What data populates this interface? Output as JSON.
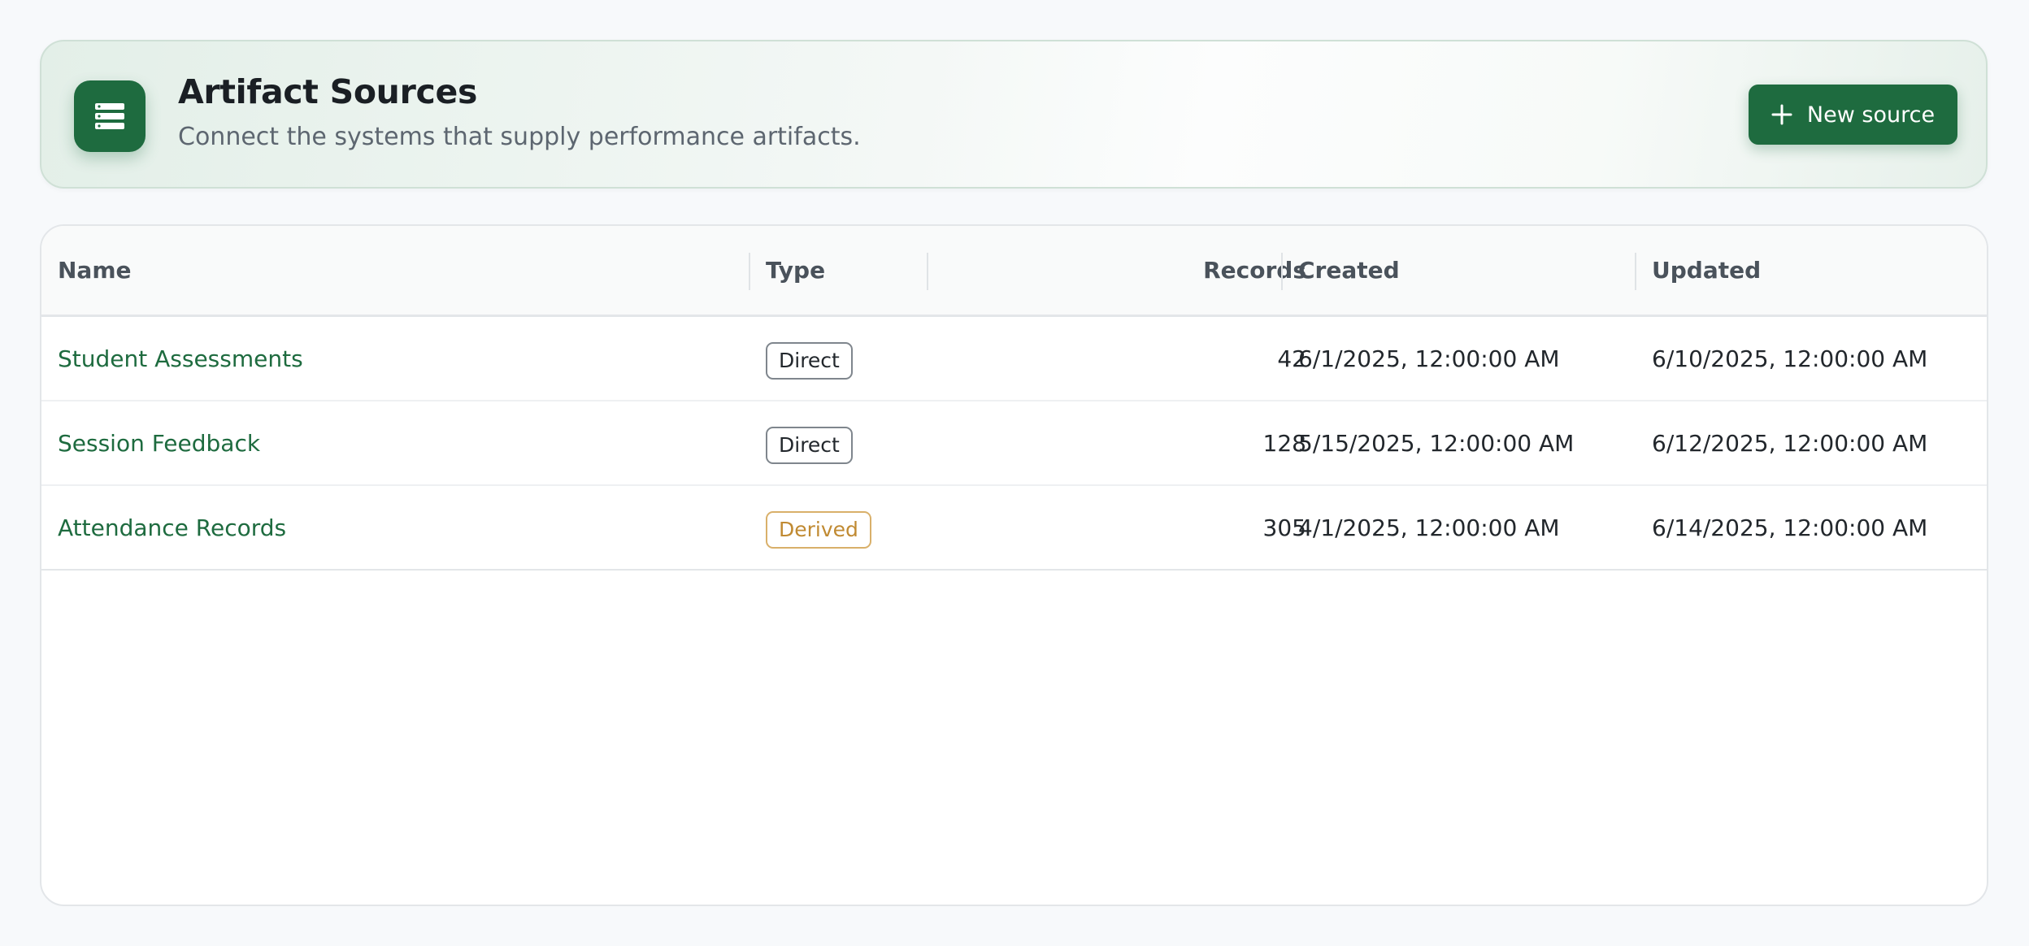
{
  "header": {
    "icon": "database-list-icon",
    "title": "Artifact Sources",
    "subtitle": "Connect the systems that supply performance artifacts.",
    "new_source_label": "New source",
    "new_source_icon": "plus-icon",
    "accent_color": "#1e6b3f"
  },
  "table": {
    "columns": {
      "name": "Name",
      "type": "Type",
      "records": "Records",
      "created": "Created",
      "updated": "Updated"
    },
    "rows": [
      {
        "name": "Student Assessments",
        "type": "Direct",
        "records": "42",
        "created": "6/1/2025, 12:00:00 AM",
        "updated": "6/10/2025, 12:00:00 AM"
      },
      {
        "name": "Session Feedback",
        "type": "Direct",
        "records": "128",
        "created": "5/15/2025, 12:00:00 AM",
        "updated": "6/12/2025, 12:00:00 AM"
      },
      {
        "name": "Attendance Records",
        "type": "Derived",
        "records": "305",
        "created": "4/1/2025, 12:00:00 AM",
        "updated": "6/14/2025, 12:00:00 AM"
      }
    ],
    "type_colors": {
      "Direct": "#22272c",
      "Derived": "#c08a32"
    }
  }
}
